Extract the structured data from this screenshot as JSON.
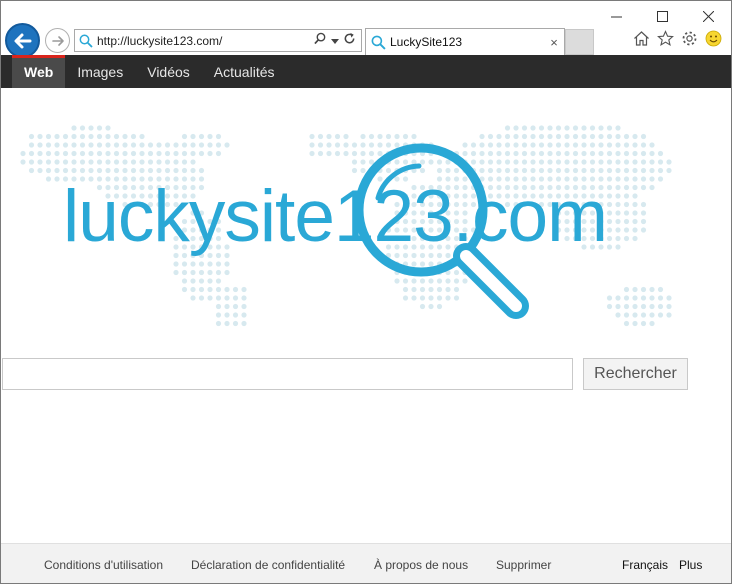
{
  "browser": {
    "address_url": "http://luckysite123.com/",
    "tab_title": "LuckySite123",
    "tab_close": "×"
  },
  "search_nav": {
    "items": [
      "Web",
      "Images",
      "Vidéos",
      "Actualités"
    ],
    "active_index": 0
  },
  "logo": {
    "text": "luckysite123.com",
    "color": "#2aa8d6"
  },
  "search": {
    "input_value": "",
    "button_label": "Rechercher"
  },
  "footer": {
    "links": [
      "Conditions d'utilisation",
      "Déclaration de confidentialité",
      "À propos de nous",
      "Supprimer"
    ],
    "language": "Français",
    "more": "Plus"
  },
  "colors": {
    "nav_bg": "#2b2b2b",
    "nav_active_accent": "#d9241c",
    "back_button": "#1e73be",
    "map_dots": "#d7e9ef"
  }
}
